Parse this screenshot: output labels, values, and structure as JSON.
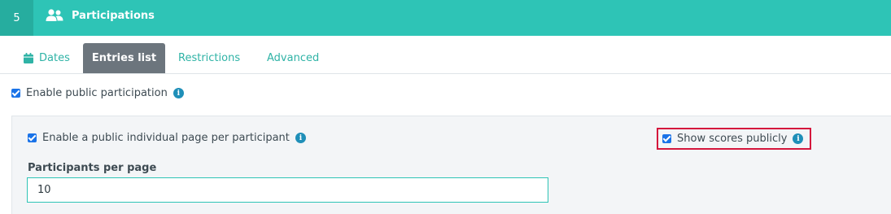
{
  "header": {
    "step_number": "5",
    "icon": "users-icon",
    "title": "Participations",
    "colors": {
      "bar": "#2ec4b6",
      "step_bg": "#26ad9f"
    }
  },
  "tabs": [
    {
      "label": "Dates",
      "icon": "calendar-icon",
      "active": false
    },
    {
      "label": "Entries list",
      "active": true
    },
    {
      "label": "Restrictions",
      "active": false
    },
    {
      "label": "Advanced",
      "active": false
    }
  ],
  "settings": {
    "enable_public_participation": {
      "label": "Enable public participation",
      "checked": true
    },
    "enable_individual_page": {
      "label": "Enable a public individual page per participant",
      "checked": true
    },
    "show_scores_publicly": {
      "label": "Show scores publicly",
      "checked": true,
      "highlight_color": "#d4163c"
    },
    "participants_per_page": {
      "label": "Participants per page",
      "value": "10"
    }
  },
  "info_glyph": "i"
}
